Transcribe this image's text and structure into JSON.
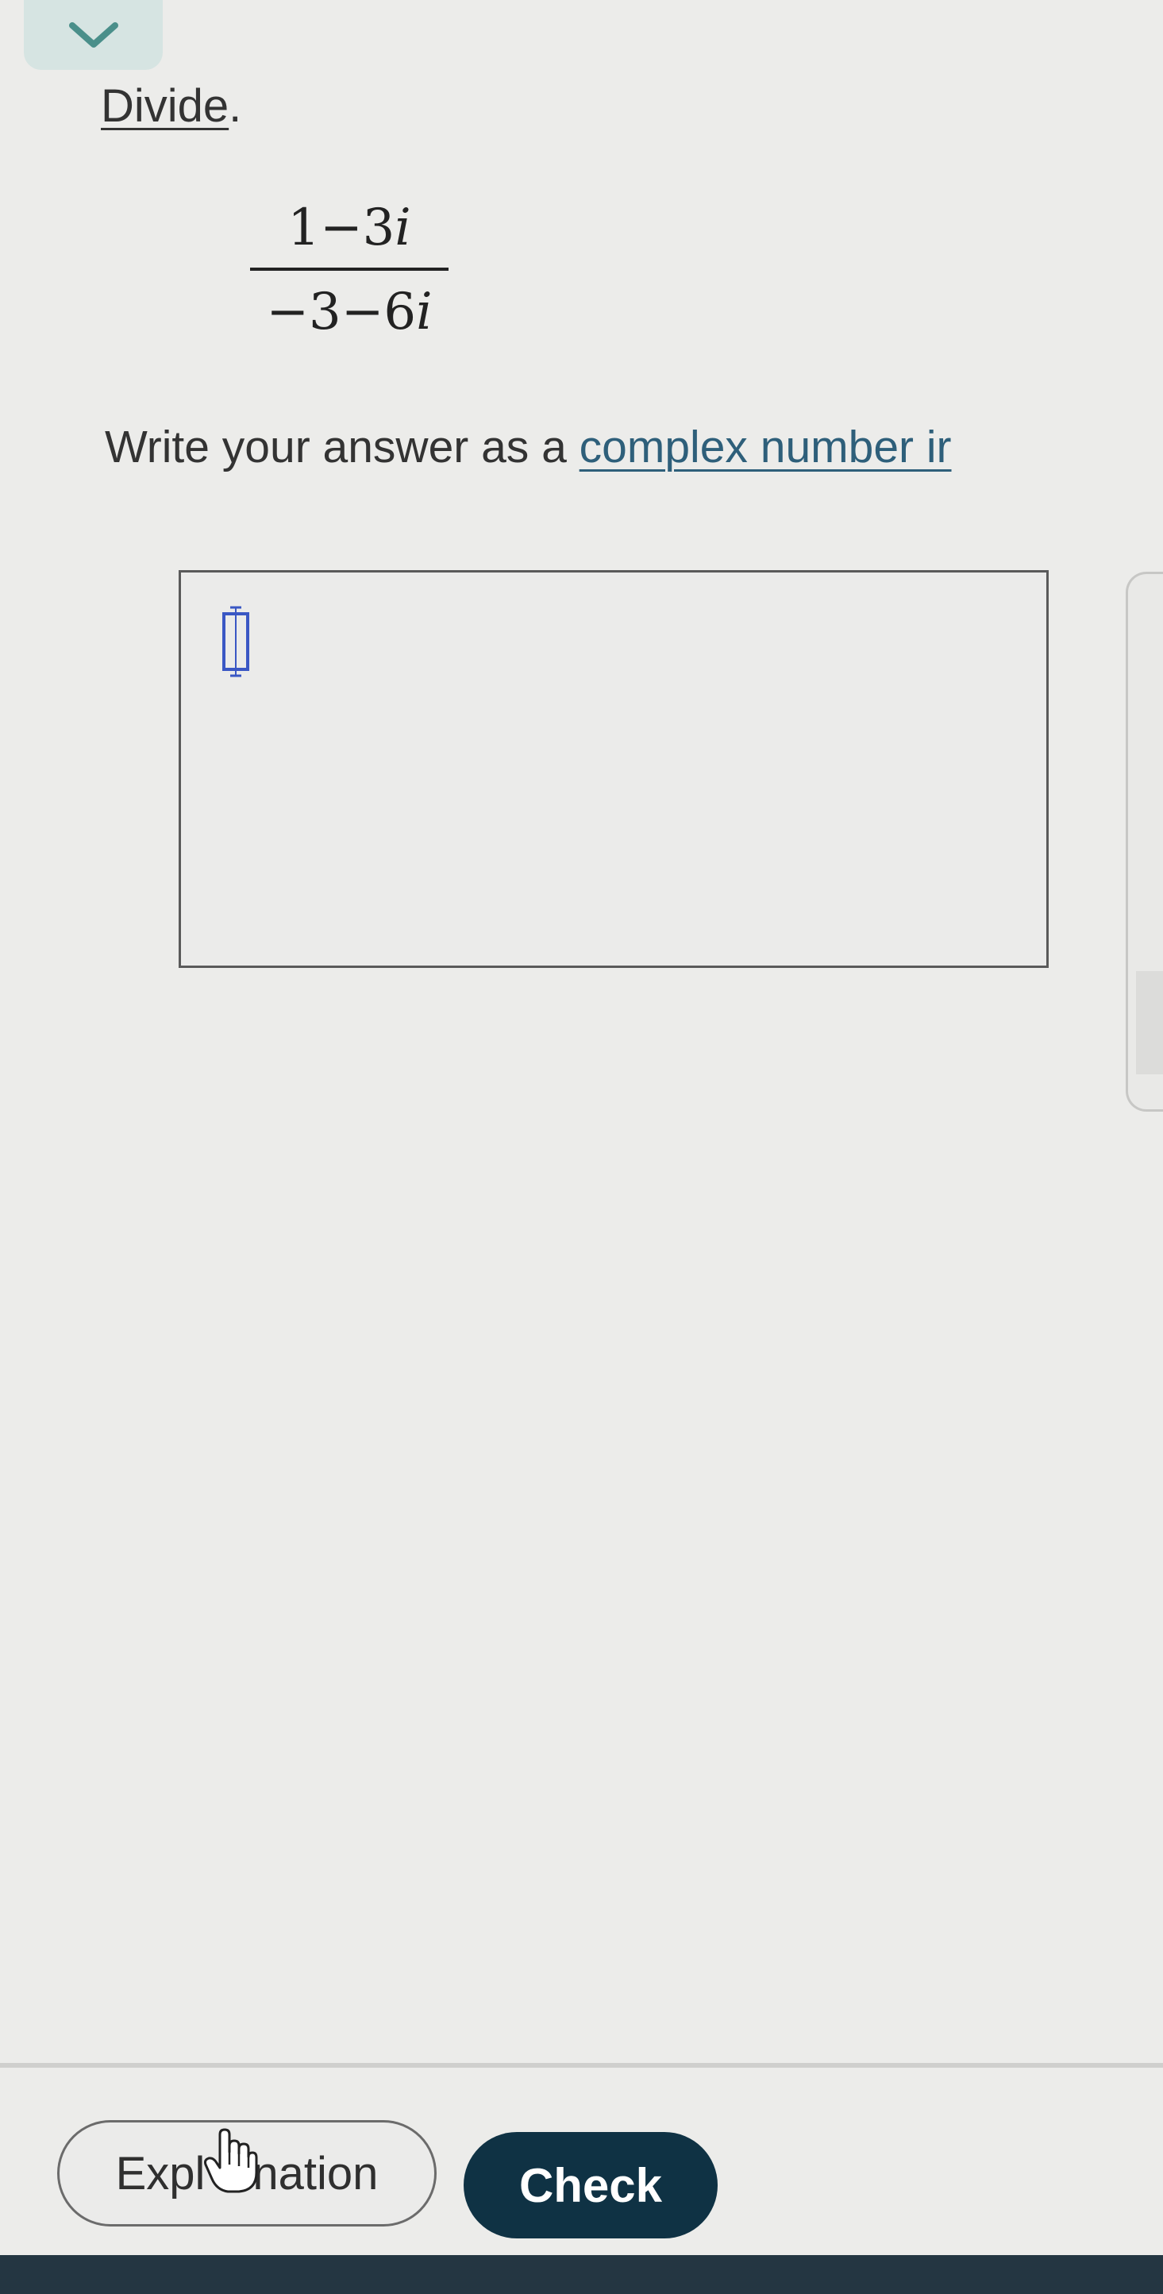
{
  "collapse": {
    "icon": "chevron-down-icon",
    "color": "#4a8f8a"
  },
  "question": {
    "verb": "Divide",
    "period": "."
  },
  "expression": {
    "numerator": {
      "a": "1",
      "minus": "−",
      "b": "3",
      "unit": "i"
    },
    "denominator": {
      "sign": "−",
      "a": "3",
      "minus": "−",
      "b": "6",
      "unit": "i"
    }
  },
  "instruction": {
    "text_before": "Write your answer as a ",
    "link_text": "complex number ir"
  },
  "answer": {
    "value": "",
    "cursor_icon": "input-slot-icon"
  },
  "buttons": {
    "explanation_left": "Expl",
    "explanation_right": "nation",
    "check": "Check"
  },
  "colors": {
    "accent": "#0f3244",
    "link": "#2e5f7a",
    "cursor_slot": "#3a57c4"
  }
}
